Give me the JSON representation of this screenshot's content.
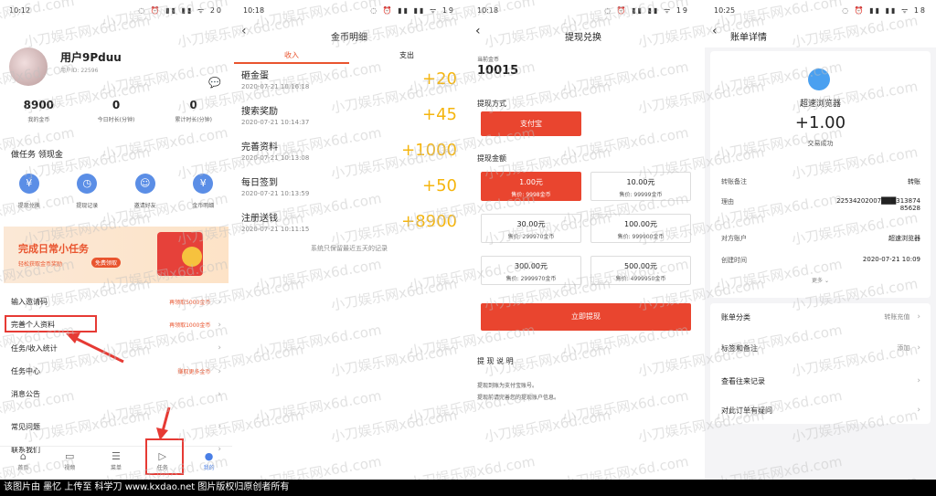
{
  "watermark": "小刀娱乐网x6d.com",
  "footer": "该图片由 墨忆 上传至 科学刀 www.kxdao.net 图片版权归原创者所有",
  "panel1": {
    "time": "10:12",
    "status_icons": "◌ ⏰ ▮▮ ▮▮ ᯤ 20",
    "username": "用户9Pduu",
    "user_id": "用户ID: 22596",
    "stats": [
      {
        "value": "8900",
        "label": "我的金币"
      },
      {
        "value": "0",
        "label": "今日时长(分钟)"
      },
      {
        "value": "0",
        "label": "累计时长(分钟)"
      }
    ],
    "section_title": "做任务 领现金",
    "tasks": [
      "提现兑换",
      "提现记录",
      "邀请好友",
      "金币明细"
    ],
    "banner": {
      "title": "完成日常小任务",
      "sub": "轻松获取金币奖励",
      "btn": "免费领取"
    },
    "menu": [
      {
        "label": "输入邀请码",
        "badge": "再领取5000金币"
      },
      {
        "label": "完善个人资料",
        "badge": "再领取1000金币"
      },
      {
        "label": "任务/收入统计",
        "badge": ""
      },
      {
        "label": "任务中心",
        "badge": "赚取更多金币"
      },
      {
        "label": "消息公告",
        "badge": ""
      },
      {
        "label": "常见问题",
        "badge": ""
      },
      {
        "label": "联系我们",
        "badge": ""
      }
    ],
    "tabs": [
      "首页",
      "视频",
      "菜单",
      "任务",
      "我的"
    ]
  },
  "panel2": {
    "time": "10:18",
    "status_icons": "◌ ⏰ ▮▮ ▮▮ ᯤ 19",
    "title": "金币明细",
    "tabs": [
      "收入",
      "支出"
    ],
    "records": [
      {
        "name": "砸金蛋",
        "date": "2020-07-21 10:16:18",
        "amount": "+20"
      },
      {
        "name": "搜索奖励",
        "date": "2020-07-21 10:14:37",
        "amount": "+45"
      },
      {
        "name": "完善资料",
        "date": "2020-07-21 10:13:08",
        "amount": "+1000"
      },
      {
        "name": "每日签到",
        "date": "2020-07-21 10:13:59",
        "amount": "+50"
      },
      {
        "name": "注册送钱",
        "date": "2020-07-21 10:11:15",
        "amount": "+8900"
      }
    ],
    "note": "系统只保留最近五天的记录"
  },
  "panel3": {
    "time": "10:18",
    "status_icons": "◌ ⏰ ▮▮ ▮▮ ᯤ 19",
    "title": "提现兑换",
    "balance_label": "当前金币",
    "balance": "10015",
    "method_label": "提现方式",
    "method": "支付宝",
    "amount_label": "提现金额",
    "amounts": [
      {
        "price": "1.00元",
        "cost": "售价: 9998金币"
      },
      {
        "price": "10.00元",
        "cost": "售价: 99999金币"
      },
      {
        "price": "30.00元",
        "cost": "售价: 299970金币"
      },
      {
        "price": "100.00元",
        "cost": "售价: 999900金币"
      },
      {
        "price": "300.00元",
        "cost": "售价: 2999970金币"
      },
      {
        "price": "500.00元",
        "cost": "售价: 4999950金币"
      }
    ],
    "withdraw_btn": "立即提现",
    "desc_title": "提 现 说 明",
    "notes": [
      "提现到账为支付宝账号。",
      "提现前请完善您的提现账户信息。"
    ]
  },
  "panel4": {
    "time": "10:25",
    "status_icons": "◌ ⏰ ▮▮ ▮▮ ᯤ 18",
    "title": "账单详情",
    "merchant": "超速浏览器",
    "amount": "+1.00",
    "status": "交易成功",
    "rows": [
      {
        "k": "转账备注",
        "v": "转账"
      },
      {
        "k": "理由",
        "v": "22534202007███313874\n85628"
      },
      {
        "k": "对方账户",
        "v": "超速浏览器"
      },
      {
        "k": "创建时间",
        "v": "2020-07-21 10:09"
      }
    ],
    "more": "更多 ⌄",
    "links": [
      {
        "k": "账单分类",
        "v": "转账充值"
      },
      {
        "k": "标签和备注",
        "v": "添加"
      },
      {
        "k": "查看往来记录",
        "v": ""
      },
      {
        "k": "对此订单有疑问",
        "v": ""
      }
    ]
  }
}
